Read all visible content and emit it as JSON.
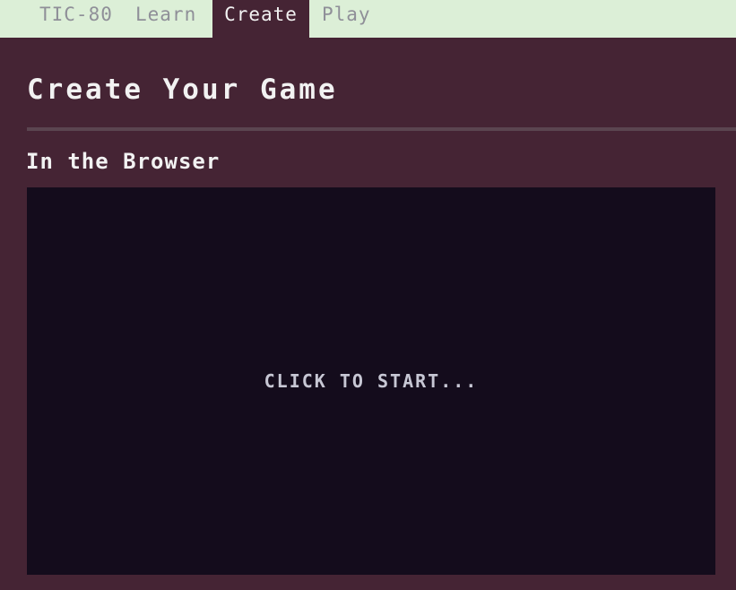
{
  "nav": {
    "items": [
      {
        "label": "TIC-80"
      },
      {
        "label": "Learn"
      },
      {
        "label": "Create",
        "active": true
      },
      {
        "label": "Play"
      }
    ]
  },
  "page": {
    "title": "Create Your Game",
    "section_title": "In the Browser"
  },
  "player": {
    "prompt": "CLICK TO START..."
  },
  "colors": {
    "nav_background": "#dcefd7",
    "page_background": "#452434",
    "player_background": "#140c1c",
    "active_text": "#f2f2f2",
    "inactive_text": "#8f8f98"
  }
}
